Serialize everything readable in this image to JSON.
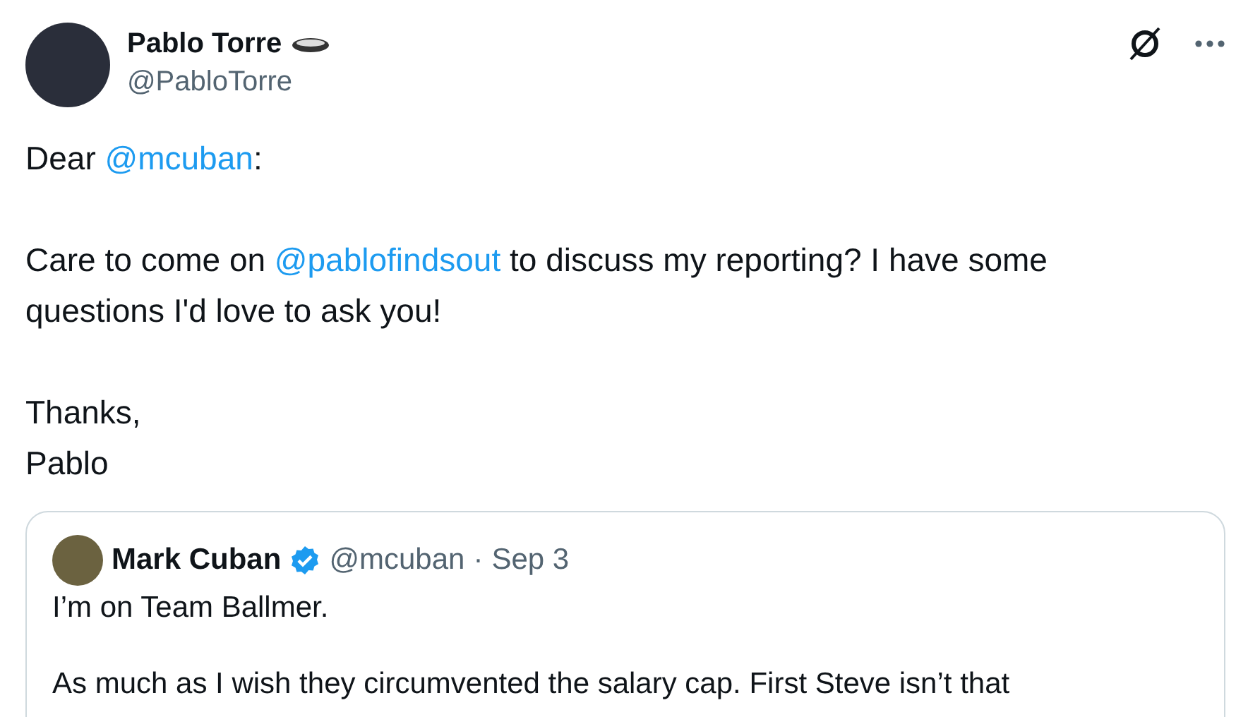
{
  "author": {
    "name": "Pablo Torre",
    "handle": "@PabloTorre"
  },
  "paragraphs": [
    [
      {
        "kind": "plain",
        "text": "Dear "
      },
      {
        "kind": "mention",
        "text": "@mcuban"
      },
      {
        "kind": "plain",
        "text": ":"
      }
    ],
    [
      {
        "kind": "plain",
        "text": "Care to come on "
      },
      {
        "kind": "mention",
        "text": "@pablofindsout"
      },
      {
        "kind": "plain",
        "text": " to discuss my reporting? I have some questions I'd love to ask you!"
      }
    ],
    [
      {
        "kind": "plain",
        "text": "Thanks,\nPablo"
      }
    ]
  ],
  "quote": {
    "name": "Mark Cuban",
    "verified": true,
    "handle": "@mcuban",
    "separator": "·",
    "date": "Sep 3",
    "paragraphs": [
      "I’m on Team Ballmer.",
      "As much as I wish they circumvented the salary cap.  First Steve isn’t that"
    ]
  }
}
